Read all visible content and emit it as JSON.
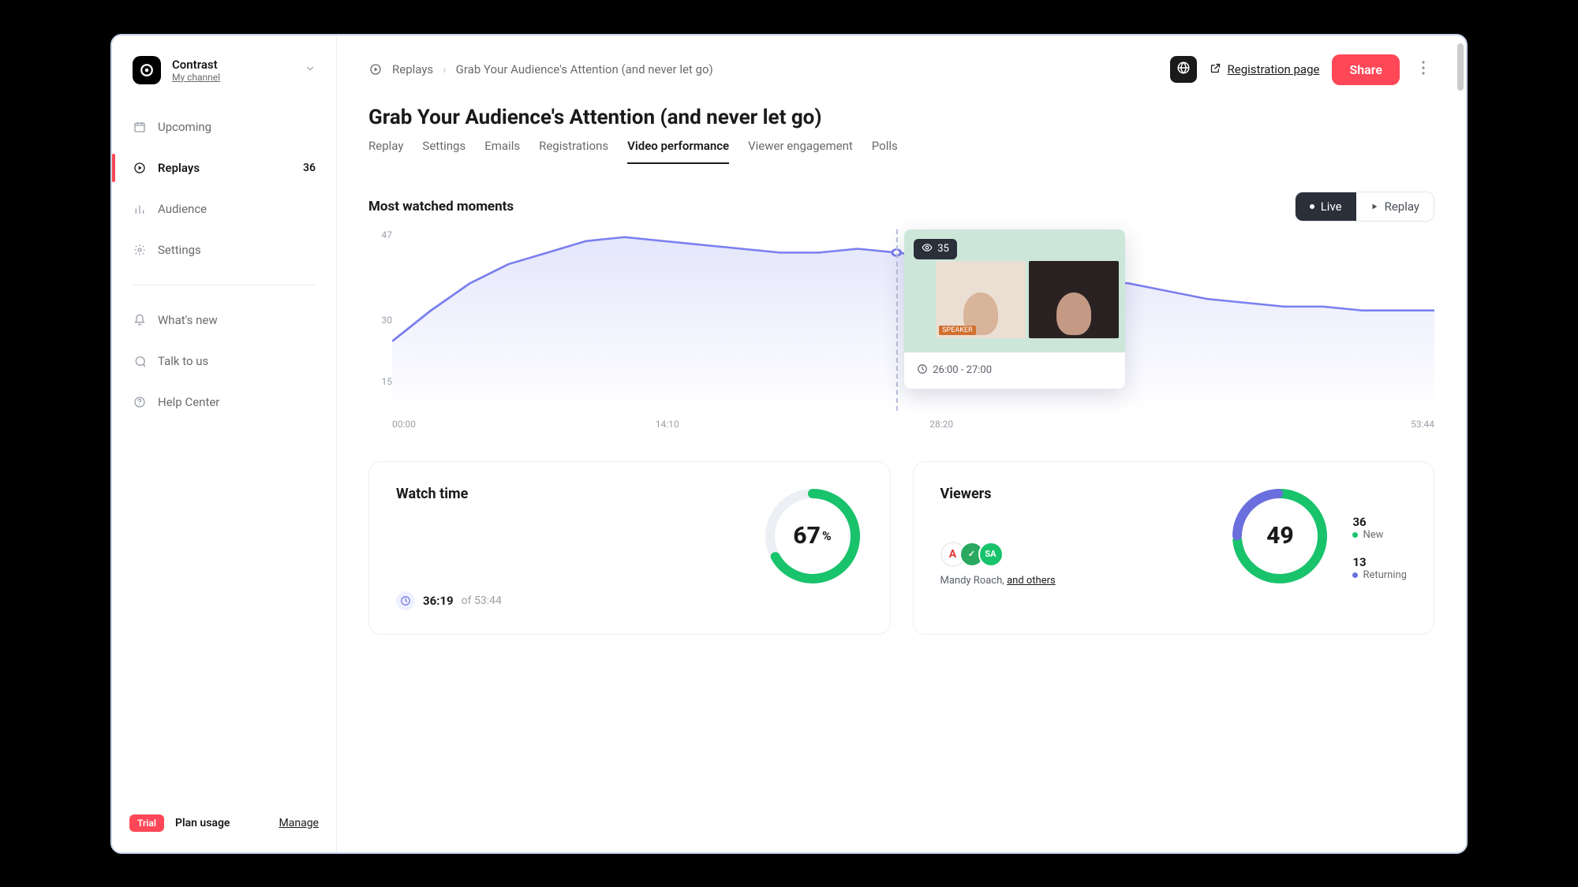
{
  "workspace": {
    "name": "Contrast",
    "subtitle": "My channel"
  },
  "sidebar": {
    "items": [
      {
        "label": "Upcoming"
      },
      {
        "label": "Replays",
        "badge": "36"
      },
      {
        "label": "Audience"
      },
      {
        "label": "Settings"
      }
    ],
    "secondary": [
      {
        "label": "What's new"
      },
      {
        "label": "Talk to us"
      },
      {
        "label": "Help Center"
      }
    ]
  },
  "footer": {
    "trial": "Trial",
    "plan": "Plan usage",
    "manage": "Manage"
  },
  "breadcrumb": {
    "root": "Replays",
    "current": "Grab Your Audience's Attention (and never let go)"
  },
  "topbar": {
    "registration": "Registration page",
    "share": "Share"
  },
  "page": {
    "title": "Grab Your Audience's Attention (and never let go)"
  },
  "tabs": [
    "Replay",
    "Settings",
    "Emails",
    "Registrations",
    "Video performance",
    "Viewer engagement",
    "Polls"
  ],
  "active_tab": "Video performance",
  "section": {
    "title": "Most watched moments"
  },
  "segmented": {
    "live": "Live",
    "replay": "Replay"
  },
  "tooltip": {
    "viewers": "35",
    "range": "26:00 - 27:00"
  },
  "cards": {
    "watch": {
      "title": "Watch time",
      "pct": "67",
      "elapsed": "36:19",
      "of": "of 53:44"
    },
    "viewers": {
      "title": "Viewers",
      "total": "49",
      "named": "Mandy Roach,",
      "others": "and others",
      "legend": [
        {
          "num": "36",
          "label": "New",
          "color": "#19c36b"
        },
        {
          "num": "13",
          "label": "Returning",
          "color": "#6a6fdd"
        }
      ]
    }
  },
  "chart_data": {
    "type": "area",
    "xlabel": "",
    "ylabel": "",
    "x_ticks": [
      "00:00",
      "14:10",
      "28:20",
      "53:44"
    ],
    "y_ticks": [
      "47",
      "30",
      "15"
    ],
    "ylim": [
      0,
      47
    ],
    "x": [
      0,
      2,
      4,
      6,
      8,
      10,
      12,
      14,
      16,
      18,
      20,
      22,
      24,
      26,
      28,
      30,
      32,
      34,
      36,
      38,
      40,
      42,
      44,
      46,
      48,
      50,
      52,
      53.73
    ],
    "values": [
      18,
      26,
      33,
      38,
      41,
      44,
      45,
      44,
      43,
      42,
      41,
      41,
      42,
      41,
      40,
      38,
      36,
      35,
      34,
      33,
      31,
      29,
      28,
      27,
      27,
      26,
      26,
      26
    ],
    "cursor_x_min": 26.0,
    "colors": {
      "stroke": "#7a7ff0",
      "fill_top": "#e4e6fb",
      "fill_bottom": "#ffffff"
    }
  }
}
